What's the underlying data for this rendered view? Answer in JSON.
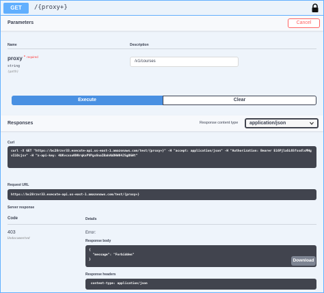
{
  "summary": {
    "method": "GET",
    "path": "/{proxy+}"
  },
  "parameters": {
    "title": "Parameters",
    "cancel_label": "Cancel",
    "col_name": "Name",
    "col_description": "Description",
    "param": {
      "name": "proxy",
      "star": "*",
      "required": "required",
      "type": "string",
      "in": "(path)",
      "value": "/v1/courses"
    }
  },
  "actions": {
    "execute_label": "Execute",
    "clear_label": "Clear"
  },
  "responses": {
    "title": "Responses",
    "content_type_label": "Response content type",
    "content_type_value": "application/json",
    "curl_label": "Curl",
    "curl": "curl -X GET \"https://bc28rzvr33.execute-api.us-east-1.amazonaws.com/test/{proxy+}\" -H \"accept: application/json\" -H \"Authorization: Bearer Ei6PjlaSL6SfssdlsMHgvIiOcjsv\" -H \"x-api-key: 4UKvcxsoKN9rqkxPVPgs6naIBahAbDHW84JSgOGWt\"",
    "request_url_label": "Request URL",
    "request_url": "https://bc28rzvr33.execute-api.us-east-1.amazonaws.com/test/{proxy+}",
    "server_response_label": "Server response",
    "col_code": "Code",
    "col_details": "Details",
    "code": "403",
    "undocumented": "Undocumented",
    "error_label": "Error:",
    "body_label": "Response body",
    "body": "{\n  \"message\": \"Forbidden\"\n}",
    "download_label": "Download",
    "headers_label": "Response headers",
    "headers": " content-type: application/json"
  },
  "colors": {
    "get_blue": "#61affe",
    "execute_blue": "#4990e2",
    "cancel_red": "#ff6060",
    "code_bg": "#41444e"
  },
  "icons": {
    "lock": "lock-icon",
    "select_arrow": "chevron-down-icon"
  }
}
